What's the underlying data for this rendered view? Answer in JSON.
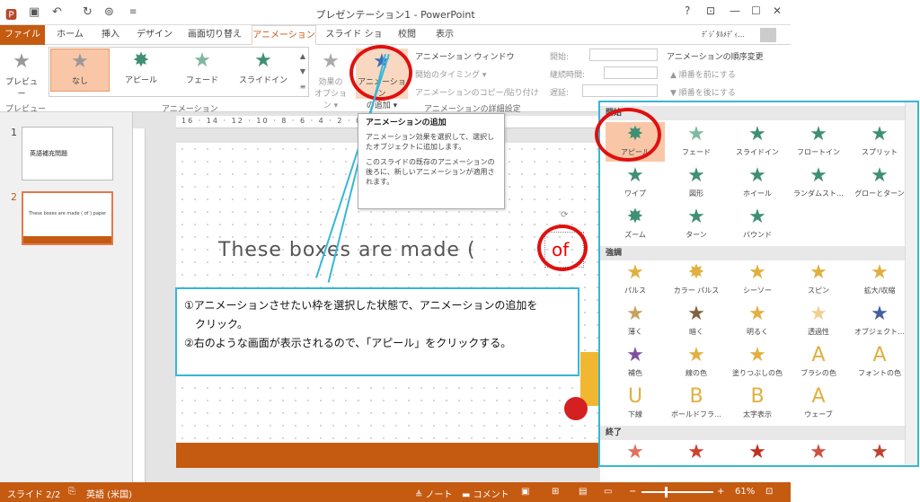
{
  "window": {
    "title": "プレゼンテーション1 - PowerPoint",
    "user": "ﾃﾞｼﾞﾀﾙﾒﾃﾞｨ…",
    "help": "?",
    "min": "—",
    "max": "☐",
    "close": "✕"
  },
  "tabs": [
    {
      "label": "ファイル"
    },
    {
      "label": "ホーム"
    },
    {
      "label": "挿入"
    },
    {
      "label": "デザイン"
    },
    {
      "label": "画面切り替え"
    },
    {
      "label": "アニメーション"
    },
    {
      "label": "スライド ショー"
    },
    {
      "label": "校閲"
    },
    {
      "label": "表示"
    }
  ],
  "ribbon": {
    "preview_label": "プレビュー",
    "preview_group": "プレビュー",
    "gallery": [
      {
        "label": "なし",
        "icon": "★"
      },
      {
        "label": "アピール",
        "icon": "✸"
      },
      {
        "label": "フェード",
        "icon": "★"
      },
      {
        "label": "スライドイン",
        "icon": "★"
      }
    ],
    "animation_group": "アニメーション",
    "effect_options_l1": "効果の",
    "effect_options_l2": "オプション ▾",
    "add_anim_l1": "アニメーション",
    "add_anim_l2": "の追加 ▾",
    "anim_window": "アニメーション ウィンドウ",
    "trigger": "開始のタイミング ▾",
    "copy_anim": "アニメーションのコピー/貼り付け",
    "advanced_group": "アニメーションの詳細設定",
    "start_label": "開始:",
    "duration_label": "継続時間:",
    "delay_label": "遅延:",
    "reorder_title": "アニメーションの順序変更",
    "move_earlier": "▲ 順番を前にする",
    "move_later": "▼ 順番を後にする"
  },
  "ruler_h": "16 · 14 · 12 · 10 · 8 · 6 · 4 · 2 · 0",
  "slides": [
    {
      "num": "1",
      "text": "英語補充問題"
    },
    {
      "num": "2",
      "text": "These  boxes  are  made  (  of  )  paper"
    }
  ],
  "slide_main": {
    "text": "These  boxes  are  made  (",
    "highlight": "of"
  },
  "tooltip": {
    "title": "アニメーションの追加",
    "body1": "アニメーション効果を選択して、選択したオブジェクトに追加します。",
    "body2": "このスライドの既存のアニメーションの後ろに、新しいアニメーションが適用されます。"
  },
  "callout": {
    "line1": "①アニメーションさせたい枠を選択した状態で、アニメーションの追加を",
    "line2": "　クリック。",
    "line3": "②右のような画面が表示されるので、「アピール」をクリックする。"
  },
  "panel": {
    "sec_start": "開始",
    "sec_emphasis": "強調",
    "sec_exit": "終了",
    "start_items": [
      {
        "label": "アピール",
        "icon": "✸",
        "color": "#3f8f74"
      },
      {
        "label": "フェード",
        "icon": "★",
        "color": "#7fb8a0"
      },
      {
        "label": "スライドイン",
        "icon": "★",
        "color": "#3f8f74"
      },
      {
        "label": "フロートイン",
        "icon": "★",
        "color": "#3f8f74"
      },
      {
        "label": "スプリット",
        "icon": "★",
        "color": "#3f8f74"
      },
      {
        "label": "ワイプ",
        "icon": "★",
        "color": "#3f8f74"
      },
      {
        "label": "図形",
        "icon": "★",
        "color": "#3f8f74"
      },
      {
        "label": "ホイール",
        "icon": "★",
        "color": "#3f8f74"
      },
      {
        "label": "ランダムスト…",
        "icon": "★",
        "color": "#3f8f74"
      },
      {
        "label": "グローとターン",
        "icon": "★",
        "color": "#3f8f74"
      },
      {
        "label": "ズーム",
        "icon": "✸",
        "color": "#3f8f74"
      },
      {
        "label": "ターン",
        "icon": "★",
        "color": "#3f8f74"
      },
      {
        "label": "バウンド",
        "icon": "★",
        "color": "#3f8f74"
      }
    ],
    "emph_items": [
      {
        "label": "パルス",
        "icon": "★",
        "color": "#e0b040"
      },
      {
        "label": "カラー パルス",
        "icon": "✸",
        "color": "#e0b040"
      },
      {
        "label": "シーソー",
        "icon": "★",
        "color": "#e0b040"
      },
      {
        "label": "スピン",
        "icon": "★",
        "color": "#e0b040"
      },
      {
        "label": "拡大/収縮",
        "icon": "★",
        "color": "#e0b040"
      },
      {
        "label": "薄く",
        "icon": "★",
        "color": "#c8a060"
      },
      {
        "label": "暗く",
        "icon": "★",
        "color": "#806040"
      },
      {
        "label": "明るく",
        "icon": "★",
        "color": "#e0b040"
      },
      {
        "label": "透過性",
        "icon": "★",
        "color": "#f0d090"
      },
      {
        "label": "オブジェクト…",
        "icon": "★",
        "color": "#4060a0"
      },
      {
        "label": "補色",
        "icon": "★",
        "color": "#8050a0"
      },
      {
        "label": "線の色",
        "icon": "★",
        "color": "#e0b040"
      },
      {
        "label": "塗りつぶしの色",
        "icon": "★",
        "color": "#e0b040"
      },
      {
        "label": "ブラシの色",
        "icon": "A",
        "color": "#e0b040"
      },
      {
        "label": "フォントの色",
        "icon": "A",
        "color": "#e0b040"
      },
      {
        "label": "下線",
        "icon": "U",
        "color": "#e0b040"
      },
      {
        "label": "ボールドフラ…",
        "icon": "B",
        "color": "#e0b040"
      },
      {
        "label": "太字表示",
        "icon": "B",
        "color": "#e0b040"
      },
      {
        "label": "ウェーブ",
        "icon": "A",
        "color": "#e0b040"
      }
    ],
    "exit_icon": "★"
  },
  "status": {
    "slide": "スライド 2/2",
    "lang": "英語 (米国)",
    "notes": "≜ ノート",
    "comments": "▬ コメント",
    "zoom": "61%"
  },
  "colors": {
    "accent": "#c55a11",
    "callout": "#38b6d7",
    "highlight": "#e01010"
  }
}
